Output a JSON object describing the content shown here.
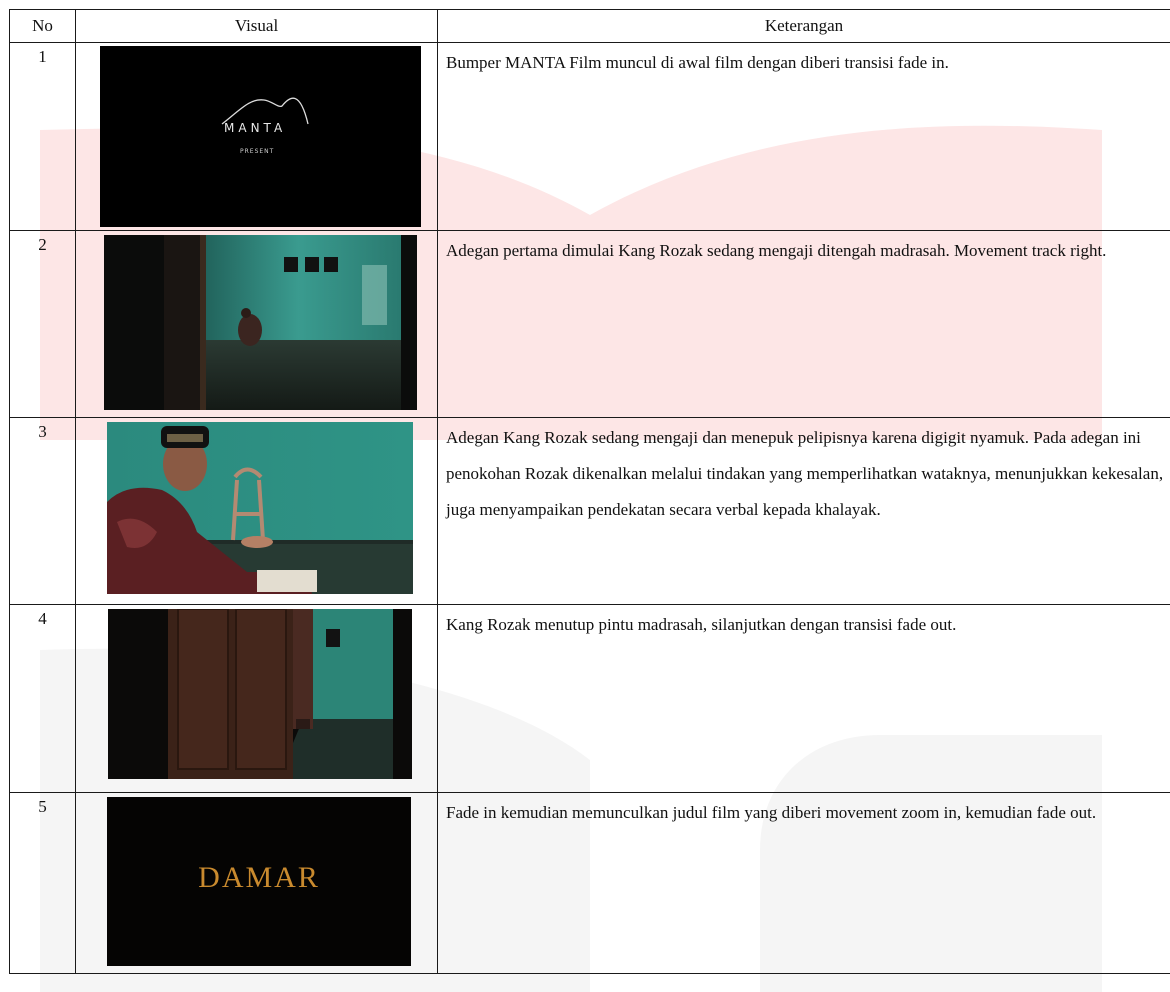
{
  "headers": {
    "no": "No",
    "visual": "Visual",
    "keterangan": "Keterangan"
  },
  "rows": [
    {
      "no": "1",
      "visual_text": "MANTA",
      "visual_subtext": "PRESENT",
      "keterangan": "Bumper MANTA Film muncul di awal film dengan diberi transisi fade in."
    },
    {
      "no": "2",
      "keterangan": "Adegan pertama dimulai Kang Rozak sedang mengaji ditengah madrasah. Movement track right."
    },
    {
      "no": "3",
      "keterangan": "Adegan Kang Rozak sedang mengaji dan menepuk pelipisnya karena digigit nyamuk. Pada adegan ini penokohan Rozak dikenalkan melalui tindakan yang memperlihatkan wataknya, menunjukkan kekesalan, juga menyampaikan pendekatan secara verbal kepada khalayak."
    },
    {
      "no": "4",
      "keterangan": "Kang Rozak menutup pintu madrasah, silanjutkan dengan transisi fade out."
    },
    {
      "no": "5",
      "visual_text": "DAMAR",
      "keterangan": "Fade in kemudian memunculkan judul film yang diberi movement zoom in, kemudian fade out."
    }
  ],
  "colors": {
    "watermark_red": "#fde3e3",
    "watermark_gray": "#f3f3f3",
    "teal_wall": "#2f8f84",
    "title_gold": "#c98a2e"
  }
}
